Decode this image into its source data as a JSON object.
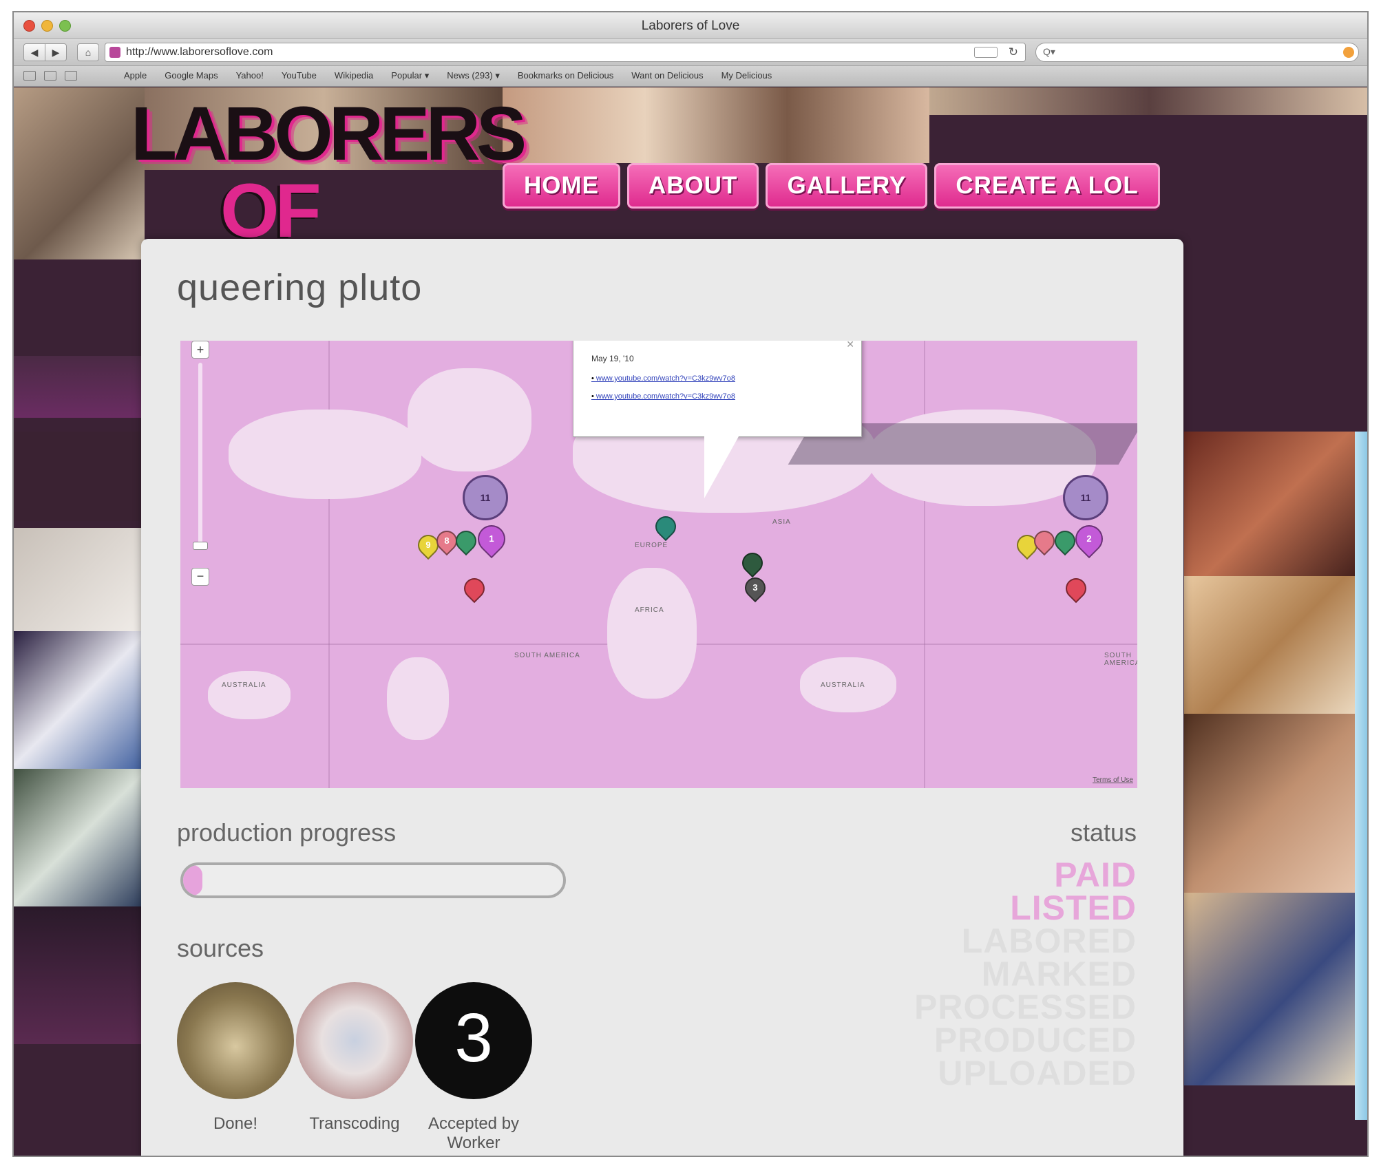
{
  "browser": {
    "window_title": "Laborers of Love",
    "url": "http://www.laborersoflove.com",
    "bookmarks": [
      "Apple",
      "Google Maps",
      "Yahoo!",
      "YouTube",
      "Wikipedia",
      "Popular ▾",
      "News (293) ▾",
      "Bookmarks on Delicious",
      "Want on Delicious",
      "My Delicious"
    ]
  },
  "site": {
    "logo_line1": "LABORERS",
    "logo_line2": "OF LOVE",
    "nav": [
      "HOME",
      "ABOUT",
      "GALLERY",
      "CREATE A LOL"
    ]
  },
  "project": {
    "title": "queering pluto"
  },
  "map": {
    "zoom_in": "+",
    "zoom_out": "−",
    "labels": [
      "EUROPE",
      "ASIA",
      "AFRICA",
      "SOUTH AMERICA",
      "AUSTRALIA",
      "AUSTRALIA",
      "SOUTH AMERICA"
    ],
    "infowindow": {
      "date": "May 19, '10",
      "links": [
        "www.youtube.com/watch?v=C3kz9wv7o8",
        "www.youtube.com/watch?v=C3kz9wv7o8"
      ]
    },
    "clusters": [
      "11",
      "11"
    ],
    "markers": [
      "9",
      "8",
      "1",
      "3",
      "2"
    ],
    "terms": "Terms of Use"
  },
  "production": {
    "label": "production progress",
    "progress_fraction": 0.05
  },
  "sources": {
    "label": "sources",
    "items": [
      {
        "caption": "Done!"
      },
      {
        "caption": "Transcoding"
      },
      {
        "caption": "Accepted by Worker",
        "number": "3"
      }
    ]
  },
  "status": {
    "label": "status",
    "items": [
      "PAID",
      "LISTED",
      "LABORED",
      "MARKED",
      "PROCESSED",
      "PRODUCED",
      "UPLOADED"
    ],
    "active_color": "#e7a6da",
    "inactive_color": "#dedede"
  },
  "colors": {
    "brand_pink": "#df2b8e",
    "map_pink": "#e3aee0",
    "background_purple": "#3b2235"
  }
}
